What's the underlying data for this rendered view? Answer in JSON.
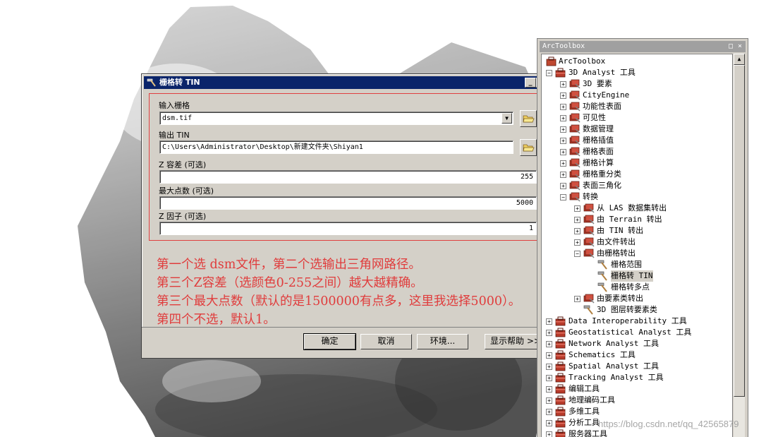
{
  "dialog": {
    "title": "栅格转 TIN",
    "fields": {
      "input_raster_label": "输入栅格",
      "input_raster_value": "dsm.tif",
      "output_tin_label": "输出 TIN",
      "output_tin_value": "C:\\Users\\Administrator\\Desktop\\新建文件夹\\Shiyan1",
      "z_tolerance_label": "Z 容差 (可选)",
      "z_tolerance_value": "255",
      "max_points_label": "最大点数 (可选)",
      "max_points_value": "5000",
      "z_factor_label": "Z 因子 (可选)",
      "z_factor_value": "1"
    },
    "notes": [
      "第一个选 dsm文件，第二个选输出三角网路径。",
      "第三个Z容差（选颜色0-255之间）越大越精确。",
      "第三个最大点数（默认的是1500000有点多，这里我选择5000）。",
      "第四个不选，默认1。"
    ],
    "buttons": {
      "ok": "确定",
      "cancel": "取消",
      "environments": "环境...",
      "show_help": "显示帮助 >>"
    },
    "icons": {
      "title": "hammer-icon",
      "browse": "folder-open-icon",
      "dropdown": "chevron-down-icon"
    }
  },
  "toolbox": {
    "title": "ArcToolbox",
    "items": [
      {
        "label": "ArcToolbox",
        "level": 0,
        "expander": "",
        "icon": "arctoolbox-icon"
      },
      {
        "label": "3D Analyst 工具",
        "level": 1,
        "expander": "−",
        "icon": "toolbox-icon"
      },
      {
        "label": "3D 要素",
        "level": 2,
        "expander": "+",
        "icon": "toolset-icon"
      },
      {
        "label": "CityEngine",
        "level": 2,
        "expander": "+",
        "icon": "toolset-icon"
      },
      {
        "label": "功能性表面",
        "level": 2,
        "expander": "+",
        "icon": "toolset-icon"
      },
      {
        "label": "可见性",
        "level": 2,
        "expander": "+",
        "icon": "toolset-icon"
      },
      {
        "label": "数据管理",
        "level": 2,
        "expander": "+",
        "icon": "toolset-icon"
      },
      {
        "label": "栅格插值",
        "level": 2,
        "expander": "+",
        "icon": "toolset-icon"
      },
      {
        "label": "栅格表面",
        "level": 2,
        "expander": "+",
        "icon": "toolset-icon"
      },
      {
        "label": "栅格计算",
        "level": 2,
        "expander": "+",
        "icon": "toolset-icon"
      },
      {
        "label": "栅格重分类",
        "level": 2,
        "expander": "+",
        "icon": "toolset-icon"
      },
      {
        "label": "表面三角化",
        "level": 2,
        "expander": "+",
        "icon": "toolset-icon"
      },
      {
        "label": "转换",
        "level": 2,
        "expander": "−",
        "icon": "toolset-icon"
      },
      {
        "label": "从 LAS 数据集转出",
        "level": 3,
        "expander": "+",
        "icon": "toolset-icon"
      },
      {
        "label": "由 Terrain 转出",
        "level": 3,
        "expander": "+",
        "icon": "toolset-icon"
      },
      {
        "label": "由 TIN 转出",
        "level": 3,
        "expander": "+",
        "icon": "toolset-icon"
      },
      {
        "label": "由文件转出",
        "level": 3,
        "expander": "+",
        "icon": "toolset-icon"
      },
      {
        "label": "由栅格转出",
        "level": 3,
        "expander": "−",
        "icon": "toolset-icon"
      },
      {
        "label": "栅格范围",
        "level": 4,
        "expander": "",
        "icon": "hammer-icon"
      },
      {
        "label": "栅格转 TIN",
        "level": 4,
        "expander": "",
        "icon": "hammer-icon",
        "selected": true
      },
      {
        "label": "栅格转多点",
        "level": 4,
        "expander": "",
        "icon": "hammer-icon"
      },
      {
        "label": "由要素类转出",
        "level": 3,
        "expander": "+",
        "icon": "toolset-icon"
      },
      {
        "label": "3D 图层转要素类",
        "level": 3,
        "expander": "",
        "icon": "hammer-icon"
      },
      {
        "label": "Data Interoperability 工具",
        "level": 1,
        "expander": "+",
        "icon": "toolbox-icon"
      },
      {
        "label": "Geostatistical Analyst 工具",
        "level": 1,
        "expander": "+",
        "icon": "toolbox-icon"
      },
      {
        "label": "Network Analyst 工具",
        "level": 1,
        "expander": "+",
        "icon": "toolbox-icon"
      },
      {
        "label": "Schematics 工具",
        "level": 1,
        "expander": "+",
        "icon": "toolbox-icon"
      },
      {
        "label": "Spatial Analyst 工具",
        "level": 1,
        "expander": "+",
        "icon": "toolbox-icon"
      },
      {
        "label": "Tracking Analyst 工具",
        "level": 1,
        "expander": "+",
        "icon": "toolbox-icon"
      },
      {
        "label": "编辑工具",
        "level": 1,
        "expander": "+",
        "icon": "toolbox-icon"
      },
      {
        "label": "地理编码工具",
        "level": 1,
        "expander": "+",
        "icon": "toolbox-icon"
      },
      {
        "label": "多维工具",
        "level": 1,
        "expander": "+",
        "icon": "toolbox-icon"
      },
      {
        "label": "分析工具",
        "level": 1,
        "expander": "+",
        "icon": "toolbox-icon"
      },
      {
        "label": "服务器工具",
        "level": 1,
        "expander": "+",
        "icon": "toolbox-icon"
      }
    ]
  },
  "watermark": "https://blog.csdn.net/qq_42565879",
  "colors": {
    "title_active": "#0a246a",
    "annotation_red": "#e03c3c",
    "window_face": "#d4d0c8",
    "toolbox_red": "#b83a2a"
  }
}
